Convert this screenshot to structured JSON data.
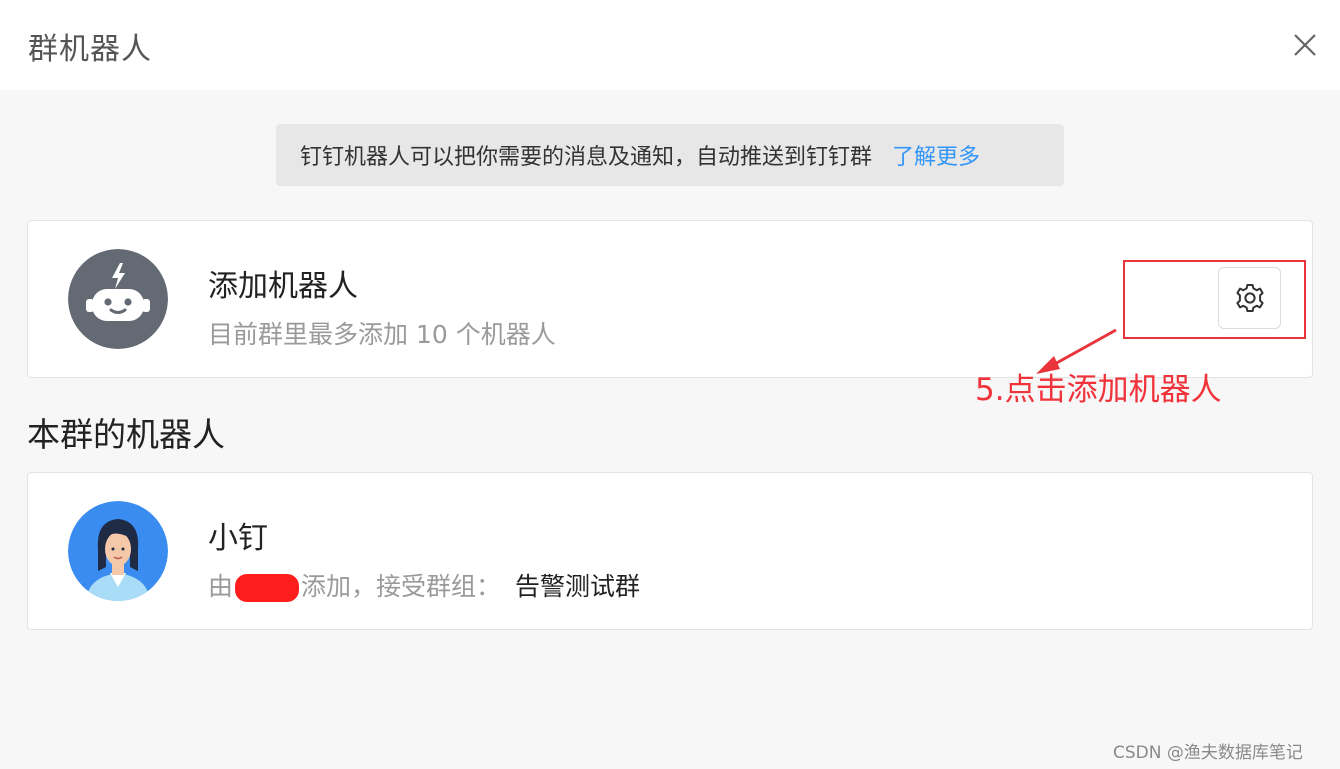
{
  "dialog": {
    "title": "群机器人"
  },
  "notice": {
    "text": "钉钉机器人可以把你需要的消息及通知，自动推送到钉钉群",
    "link": "了解更多"
  },
  "add_robot": {
    "title": "添加机器人",
    "subtitle": "目前群里最多添加 10 个机器人",
    "icon": "robot-icon",
    "settings_icon": "gear-icon"
  },
  "section": {
    "title": "本群的机器人"
  },
  "robots": [
    {
      "name": "小钉",
      "added_by_prefix": "由",
      "added_by_suffix": "添加，接受群组：",
      "group": "告警测试群"
    }
  ],
  "annotation": {
    "text": "5.点击添加机器人",
    "color": "#f0323a"
  },
  "watermark": "CSDN @渔夫数据库笔记",
  "colors": {
    "link": "#3296fa",
    "robot_icon_bg": "#646a73",
    "avatar_bg": "#3a8cf0"
  }
}
